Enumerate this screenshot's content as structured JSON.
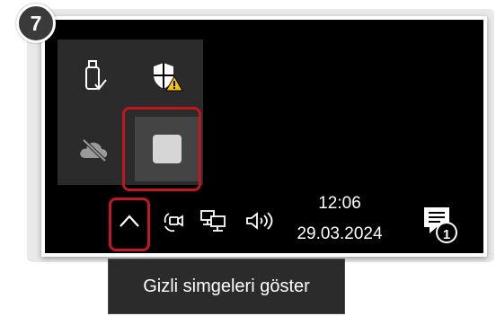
{
  "step": {
    "number": "7"
  },
  "overflow_tray": {
    "items": [
      {
        "icon": "usb-drive-icon"
      },
      {
        "icon": "windows-security-warning-icon"
      },
      {
        "icon": "onedrive-offline-icon"
      },
      {
        "icon": "blank-app-icon"
      }
    ]
  },
  "taskbar": {
    "show_hidden_icon": "chevron-up-icon",
    "icons": [
      "meet-now-icon",
      "network-icon",
      "volume-icon"
    ],
    "time": "12:06",
    "date": "29.03.2024",
    "notification_count": "1"
  },
  "tooltip": {
    "text": "Gizli simgeleri göster"
  },
  "colors": {
    "highlight": "#c1171e",
    "taskbar_bg": "#000000",
    "panel_bg": "#2b2b2b",
    "warning": "#f3c200"
  }
}
